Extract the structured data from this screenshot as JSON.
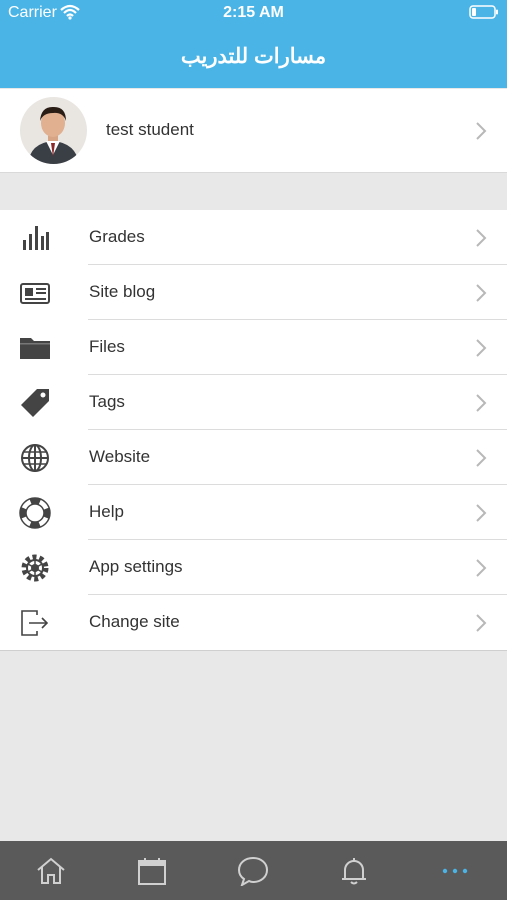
{
  "status_bar": {
    "carrier": "Carrier",
    "time": "2:15 AM",
    "wifi_icon": "wifi-icon",
    "battery_icon": "battery-icon"
  },
  "header": {
    "title": "مسارات للتدريب"
  },
  "profile": {
    "name": "test student",
    "avatar_icon": "user-avatar"
  },
  "menu": {
    "items": [
      {
        "label": "Grades",
        "icon": "bar-chart-icon"
      },
      {
        "label": "Site blog",
        "icon": "newspaper-icon"
      },
      {
        "label": "Files",
        "icon": "folder-icon"
      },
      {
        "label": "Tags",
        "icon": "tag-icon"
      },
      {
        "label": "Website",
        "icon": "globe-icon"
      },
      {
        "label": "Help",
        "icon": "lifebuoy-icon"
      },
      {
        "label": "App settings",
        "icon": "gear-icon"
      },
      {
        "label": "Change site",
        "icon": "logout-icon"
      }
    ]
  },
  "tab_bar": {
    "tabs": [
      {
        "icon": "home-icon",
        "active": false
      },
      {
        "icon": "calendar-icon",
        "active": false
      },
      {
        "icon": "chat-icon",
        "active": false
      },
      {
        "icon": "bell-icon",
        "active": false
      },
      {
        "icon": "more-icon",
        "active": true
      }
    ]
  },
  "colors": {
    "header": "#4ab4e6",
    "tab_bar": "#5a5a5a",
    "tab_active": "#4ab4e6",
    "background": "#e8e8e8"
  }
}
